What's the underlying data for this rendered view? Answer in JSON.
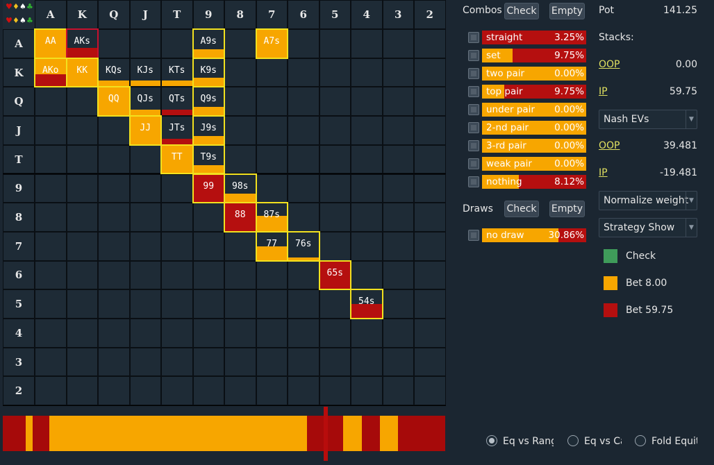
{
  "grid": {
    "ranks": [
      "A",
      "K",
      "Q",
      "J",
      "T",
      "9",
      "8",
      "7",
      "6",
      "5",
      "4",
      "3",
      "2"
    ],
    "corner_suits": [
      "♥",
      "♦",
      "♠",
      "♣"
    ],
    "hands": [
      {
        "label": "AA",
        "row": 0,
        "col": 0,
        "bet_small": 1.0,
        "bet_big": 0.0,
        "highlight": "yellow"
      },
      {
        "label": "AKs",
        "row": 0,
        "col": 1,
        "bet_small": 0.0,
        "bet_big": 0.35,
        "highlight": "red"
      },
      {
        "label": "A9s",
        "row": 0,
        "col": 5,
        "bet_small": 0.3,
        "bet_big": 0.0,
        "highlight": "yellow"
      },
      {
        "label": "A7s",
        "row": 0,
        "col": 7,
        "bet_small": 1.0,
        "bet_big": 0.0,
        "highlight": "yellow"
      },
      {
        "label": "AKo",
        "row": 1,
        "col": 0,
        "bet_small": 0.55,
        "bet_big": 0.45,
        "highlight": "yellow"
      },
      {
        "label": "KK",
        "row": 1,
        "col": 1,
        "bet_small": 1.0,
        "bet_big": 0.0,
        "highlight": "yellow"
      },
      {
        "label": "KQs",
        "row": 1,
        "col": 2,
        "bet_small": 0.2,
        "bet_big": 0.0,
        "highlight": "none"
      },
      {
        "label": "KJs",
        "row": 1,
        "col": 3,
        "bet_small": 0.2,
        "bet_big": 0.0,
        "highlight": "none"
      },
      {
        "label": "KTs",
        "row": 1,
        "col": 4,
        "bet_small": 0.2,
        "bet_big": 0.0,
        "highlight": "none"
      },
      {
        "label": "K9s",
        "row": 1,
        "col": 5,
        "bet_small": 0.3,
        "bet_big": 0.0,
        "highlight": "yellow"
      },
      {
        "label": "QQ",
        "row": 2,
        "col": 2,
        "bet_small": 1.0,
        "bet_big": 0.0,
        "highlight": "yellow"
      },
      {
        "label": "QJs",
        "row": 2,
        "col": 3,
        "bet_small": 0.2,
        "bet_big": 0.0,
        "highlight": "none"
      },
      {
        "label": "QTs",
        "row": 2,
        "col": 4,
        "bet_small": 0.0,
        "bet_big": 0.2,
        "highlight": "none"
      },
      {
        "label": "Q9s",
        "row": 2,
        "col": 5,
        "bet_small": 0.3,
        "bet_big": 0.0,
        "highlight": "yellow"
      },
      {
        "label": "JJ",
        "row": 3,
        "col": 3,
        "bet_small": 1.0,
        "bet_big": 0.0,
        "highlight": "yellow"
      },
      {
        "label": "JTs",
        "row": 3,
        "col": 4,
        "bet_small": 0.0,
        "bet_big": 0.2,
        "highlight": "none"
      },
      {
        "label": "J9s",
        "row": 3,
        "col": 5,
        "bet_small": 0.3,
        "bet_big": 0.0,
        "highlight": "yellow"
      },
      {
        "label": "TT",
        "row": 4,
        "col": 4,
        "bet_small": 1.0,
        "bet_big": 0.0,
        "highlight": "yellow"
      },
      {
        "label": "T9s",
        "row": 4,
        "col": 5,
        "bet_small": 0.3,
        "bet_big": 0.0,
        "highlight": "yellow"
      },
      {
        "label": "99",
        "row": 5,
        "col": 5,
        "bet_small": 0.0,
        "bet_big": 1.0,
        "highlight": "yellow"
      },
      {
        "label": "98s",
        "row": 5,
        "col": 6,
        "bet_small": 0.3,
        "bet_big": 0.0,
        "highlight": "yellow"
      },
      {
        "label": "88",
        "row": 6,
        "col": 6,
        "bet_small": 0.0,
        "bet_big": 1.0,
        "highlight": "yellow"
      },
      {
        "label": "87s",
        "row": 6,
        "col": 7,
        "bet_small": 0.55,
        "bet_big": 0.0,
        "highlight": "yellow"
      },
      {
        "label": "77",
        "row": 7,
        "col": 7,
        "bet_small": 0.5,
        "bet_big": 0.0,
        "highlight": "yellow"
      },
      {
        "label": "76s",
        "row": 7,
        "col": 8,
        "bet_small": 0.1,
        "bet_big": 0.0,
        "highlight": "yellow"
      },
      {
        "label": "65s",
        "row": 8,
        "col": 9,
        "bet_small": 0.0,
        "bet_big": 1.0,
        "highlight": "yellow"
      },
      {
        "label": "54s",
        "row": 9,
        "col": 10,
        "bet_small": 0.0,
        "bet_big": 0.5,
        "highlight": "yellow"
      }
    ]
  },
  "strategy_bar": {
    "segments": [
      {
        "color": "#a60a0a",
        "fraction": 0.052
      },
      {
        "color": "#f7a600",
        "fraction": 0.015
      },
      {
        "color": "#a60a0a",
        "fraction": 0.038
      },
      {
        "color": "#f7a600",
        "fraction": 0.582
      },
      {
        "color": "#a60a0a",
        "fraction": 0.083
      },
      {
        "color": "#f7a600",
        "fraction": 0.042
      },
      {
        "color": "#a60a0a",
        "fraction": 0.04
      },
      {
        "color": "#f7a600",
        "fraction": 0.042
      },
      {
        "color": "#a60a0a",
        "fraction": 0.106
      }
    ],
    "marker_fraction": 0.73
  },
  "combos": {
    "label": "Combos",
    "check_label": "Check",
    "empty_label": "Empty",
    "categories": [
      {
        "name": "straight",
        "value": "3.25%",
        "orange_fraction": 0.0
      },
      {
        "name": "set",
        "value": "9.75%",
        "orange_fraction": 0.29
      },
      {
        "name": "two pair",
        "value": "0.00%",
        "orange_fraction": 1.0
      },
      {
        "name": "top pair",
        "value": "9.75%",
        "orange_fraction": 0.21
      },
      {
        "name": "under pair",
        "value": "0.00%",
        "orange_fraction": 1.0
      },
      {
        "name": "2-nd pair",
        "value": "0.00%",
        "orange_fraction": 1.0
      },
      {
        "name": "3-rd pair",
        "value": "0.00%",
        "orange_fraction": 1.0
      },
      {
        "name": "weak pair",
        "value": "0.00%",
        "orange_fraction": 1.0
      },
      {
        "name": "nothing",
        "value": "8.12%",
        "orange_fraction": 0.35
      }
    ]
  },
  "draws": {
    "label": "Draws",
    "check_label": "Check",
    "empty_label": "Empty",
    "categories": [
      {
        "name": "no draw",
        "value": "30.86%",
        "orange_fraction": 0.73
      }
    ]
  },
  "info": {
    "pot_label": "Pot",
    "pot_value": "141.25",
    "stacks_label": "Stacks:",
    "stack_oop_label": "OOP",
    "stack_oop_value": "0.00",
    "stack_ip_label": "IP",
    "stack_ip_value": "59.75",
    "ev_select": "Nash EVs",
    "ev_oop_label": "OOP",
    "ev_oop_value": "39.481",
    "ev_ip_label": "IP",
    "ev_ip_value": "-19.481",
    "normalize_select": "Normalize weight",
    "strategy_select": "Strategy Show"
  },
  "legend": [
    {
      "label": "Check",
      "color": "#3f9c5a"
    },
    {
      "label": "Bet 8.00",
      "color": "#f7a600"
    },
    {
      "label": "Bet 59.75",
      "color": "#b50f0f"
    }
  ],
  "radios": [
    {
      "label": "Eq vs Range",
      "selected": true
    },
    {
      "label": "Eq vs Ca",
      "selected": false
    },
    {
      "label": "Fold Equity",
      "selected": false
    }
  ],
  "colors": {
    "bet_small": "#f7a600",
    "bet_big": "#b50f0f",
    "check": "#3f9c5a",
    "highlight_yellow": "#f2e11e",
    "highlight_red": "#c8102e"
  }
}
